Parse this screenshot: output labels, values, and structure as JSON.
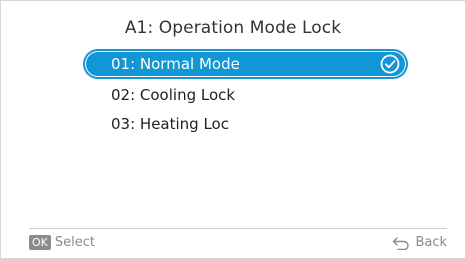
{
  "screen": {
    "title": "A1: Operation Mode Lock"
  },
  "options": [
    {
      "label": "01: Normal Mode",
      "selected": true
    },
    {
      "label": "02: Cooling Lock",
      "selected": false
    },
    {
      "label": "03: Heating Loc",
      "selected": false
    }
  ],
  "footer": {
    "ok_badge": "OK",
    "select_label": "Select",
    "back_label": "Back"
  },
  "icons": {
    "check": "check-circle-icon",
    "back": "back-arrow-icon"
  },
  "colors": {
    "selection": "#1296d4",
    "text": "#222222",
    "hint": "#8a8a8a"
  }
}
